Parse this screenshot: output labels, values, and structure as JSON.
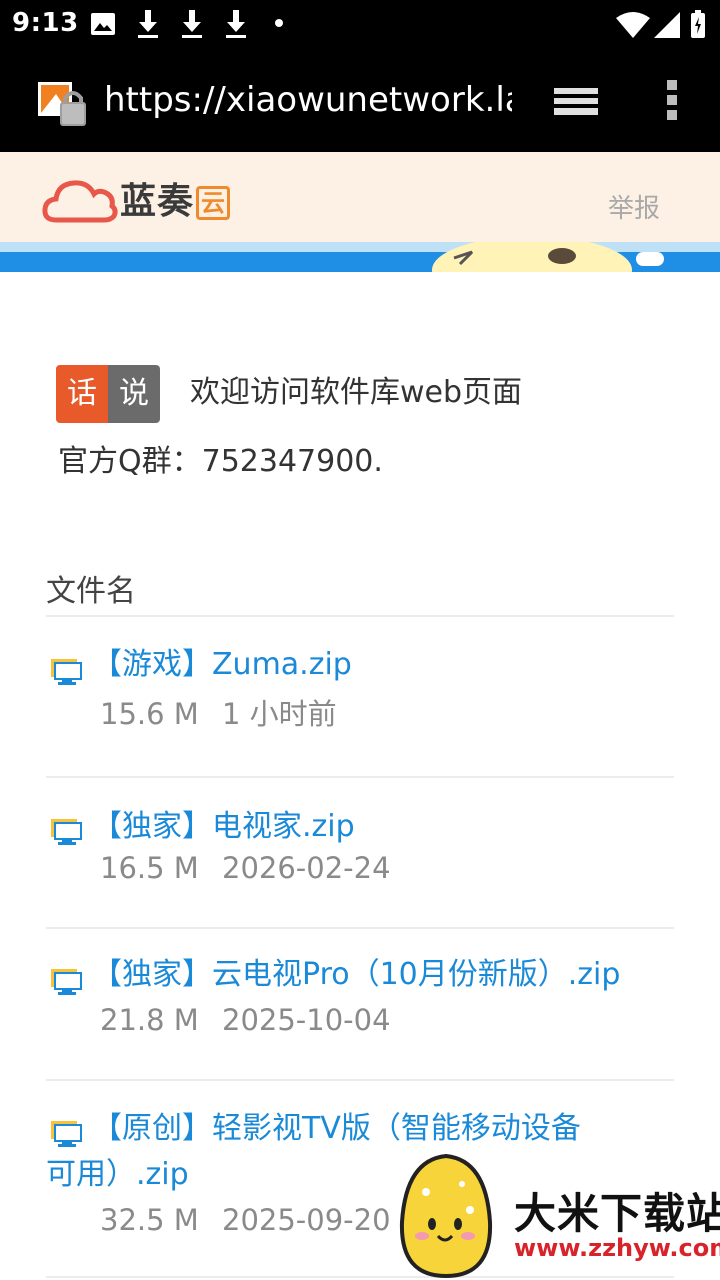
{
  "status_bar": {
    "time": "9:13",
    "icons": [
      "image-icon",
      "download-icon",
      "download-icon",
      "download-icon",
      "dot-icon",
      "wifi-icon",
      "signal-icon",
      "battery-icon"
    ]
  },
  "browser": {
    "url": "https://xiaowunetwork.lanzou",
    "menu_icons": [
      "tabs-icon",
      "overflow-menu-icon"
    ]
  },
  "site": {
    "brand": "蓝奏",
    "brand_tag": "云",
    "report": "举报",
    "brand_color": "#e85a2a"
  },
  "intro": {
    "badge_left": "话",
    "badge_right": "说",
    "welcome": "欢迎访问软件库web页面",
    "qq_group": "官方Q群：752347900."
  },
  "list": {
    "column_header": "文件名",
    "files": [
      {
        "name": "【游戏】Zuma.zip",
        "size": "15.6 M",
        "time": "1 小时前"
      },
      {
        "name": "【独家】电视家.zip",
        "size": "16.5 M",
        "time": "2026-02-24"
      },
      {
        "name": "【独家】云电视Pro（10月份新版）.zip",
        "size": "21.8 M",
        "time": "2025-10-04"
      },
      {
        "name": "【原创】轻影视TV版（智能移动设备可用）.zip",
        "size": "32.5 M",
        "time": "2025-09-20"
      }
    ]
  },
  "watermark": {
    "title": "大米下载站",
    "url": "www.zzhyw.com"
  }
}
